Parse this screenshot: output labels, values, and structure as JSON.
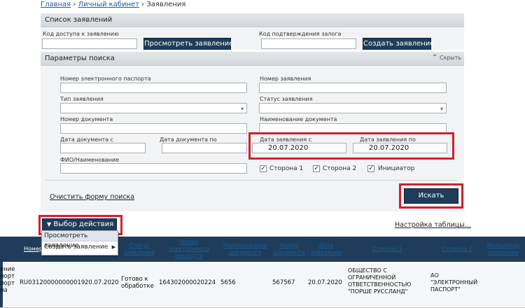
{
  "breadcrumb": {
    "home": "Главная",
    "cabinet": "Личный кабинет",
    "current": "Заявления",
    "sep": "›"
  },
  "list_panel": {
    "title": "Список заявлений",
    "access_code_label": "Код доступа к заявлению",
    "access_code_value": "",
    "view_button": "Просмотреть заявление",
    "pledge_code_label": "Код подтверждения залога",
    "pledge_code_value": "",
    "create_button": "Создать заявление"
  },
  "search_panel": {
    "title": "Параметры поиска",
    "collapse_label": "Скрыть",
    "fields": {
      "passport_number": {
        "label": "Номер электронного паспорта",
        "value": ""
      },
      "application_number": {
        "label": "Номер заявления",
        "value": ""
      },
      "application_type": {
        "label": "Тип заявления",
        "value": ""
      },
      "application_status": {
        "label": "Статус заявления",
        "value": ""
      },
      "document_number": {
        "label": "Номер документа",
        "value": ""
      },
      "document_name": {
        "label": "Наименование документа",
        "value": ""
      },
      "doc_date_from": {
        "label": "Дата документа с",
        "value": ""
      },
      "doc_date_to": {
        "label": "Дата документа по",
        "value": ""
      },
      "app_date_from": {
        "label": "Дата заявления с",
        "value": "20.07.2020"
      },
      "app_date_to": {
        "label": "Дата заявления по",
        "value": "20.07.2020"
      },
      "fio": {
        "label": "ФИО/Наименование",
        "value": ""
      }
    },
    "checkboxes": [
      {
        "label": "Сторона 1",
        "checked": true,
        "mark": "✓"
      },
      {
        "label": "Сторона 2",
        "checked": true,
        "mark": "✓"
      },
      {
        "label": "Инициатор",
        "checked": true,
        "mark": "✓"
      }
    ],
    "clear_link": "Очистить форму поиска",
    "search_button": "Искать"
  },
  "actions": {
    "button": "Выбор действия",
    "menu": [
      {
        "label": "Просмотреть заявление"
      },
      {
        "label": "Создать заявление",
        "arrow": "▶"
      }
    ],
    "table_settings": "Настройка таблицы..."
  },
  "table": {
    "columns": [
      "Номер электронного паспорта",
      "Наименование документа",
      "Номер документа",
      "Дата заявления",
      "Сторона 1",
      "Сторона 2",
      "Инициатор заявления"
    ],
    "partial_col_1": "Номер",
    "partial_col_2": "Статус заявления",
    "row": {
      "left_cut": "ение портпорт на",
      "app_number": "RU031200000000019",
      "date": "20.07.2020",
      "status": "Готово к обработке",
      "passport": "164302000020224",
      "doc_name": "5656",
      "doc_number": "567567",
      "app_date": "20.07.2020",
      "side1": "ОБЩЕСТВО С ОГРАНИЧЕННОЙ ОТВЕТСТВЕННОСТЬЮ \"ПОРШЕ РУССЛАНД\"",
      "side2": "АО \"ЭЛЕКТРОННЫЙ ПАСПОРТ\""
    }
  },
  "colors": {
    "accent_dark": "#1f3d5a",
    "highlight": "#d0202e",
    "link": "#1a5c96"
  }
}
